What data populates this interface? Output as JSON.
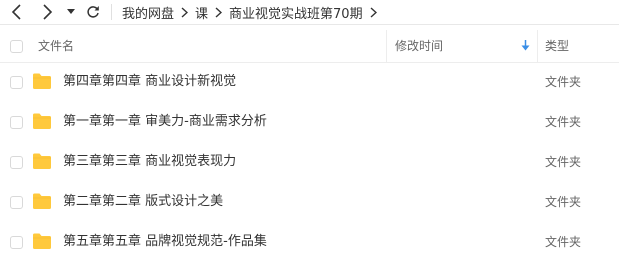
{
  "breadcrumb": [
    "我的网盘",
    "课",
    "商业视觉实战班第70期"
  ],
  "columns": {
    "name": "文件名",
    "modified": "修改时间",
    "type": "类型"
  },
  "files": [
    {
      "name": "第四章第四章 商业设计新视觉",
      "type": "文件夹"
    },
    {
      "name": "第一章第一章 审美力-商业需求分析",
      "type": "文件夹"
    },
    {
      "name": "第三章第三章 商业视觉表现力",
      "type": "文件夹"
    },
    {
      "name": "第二章第二章 版式设计之美",
      "type": "文件夹"
    },
    {
      "name": "第五章第五章 品牌视觉规范-作品集",
      "type": "文件夹"
    }
  ],
  "colors": {
    "folder": "#ffc93c",
    "folder_tab": "#f5b72a",
    "sort_arrow": "#3a8ee6"
  },
  "icons": [
    "back-icon",
    "forward-icon",
    "dropdown-icon",
    "refresh-icon",
    "chevron-right-icon",
    "sort-down-icon",
    "folder-icon"
  ]
}
